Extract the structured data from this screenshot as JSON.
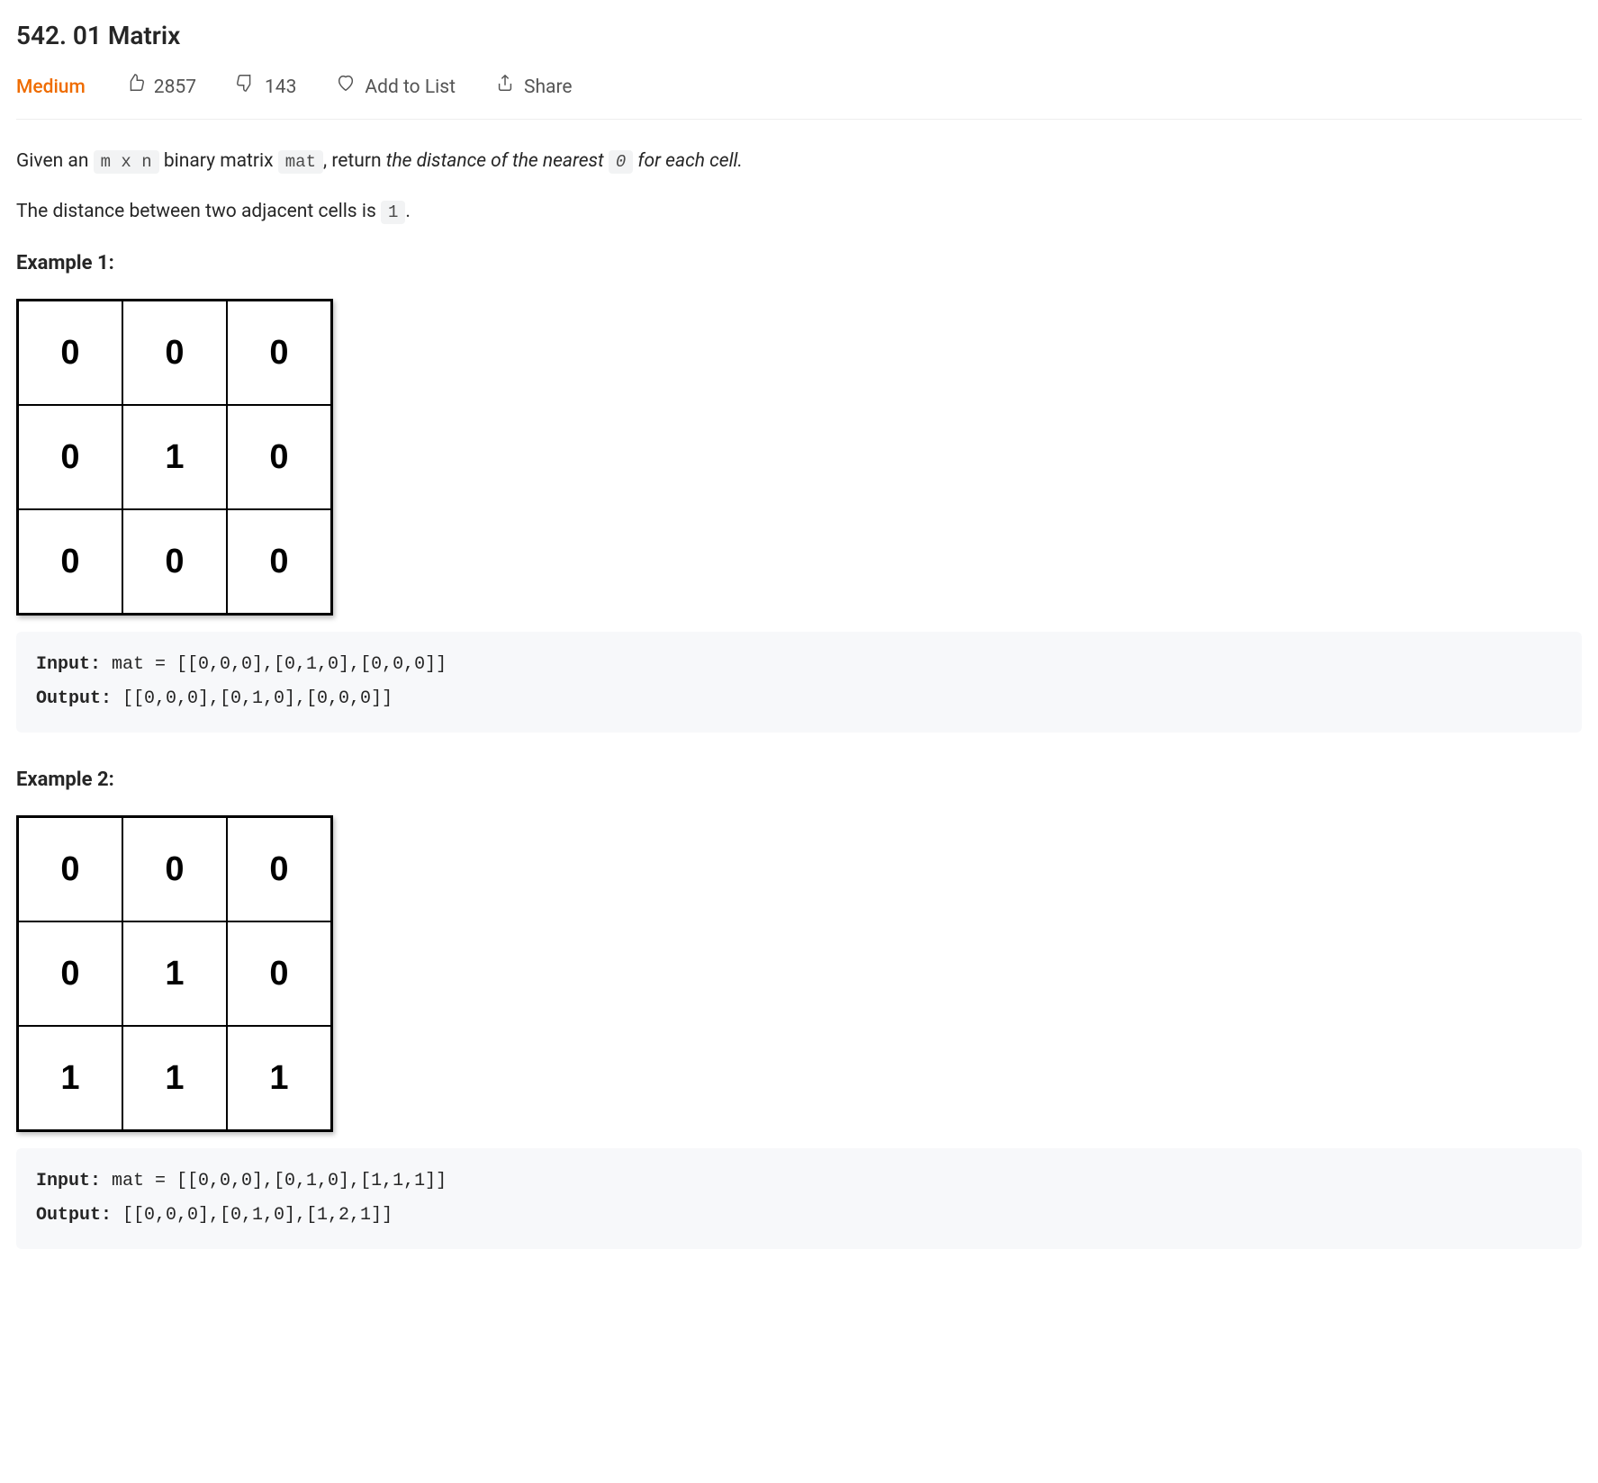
{
  "title": "542. 01 Matrix",
  "meta": {
    "difficulty": "Medium",
    "likes": "2857",
    "dislikes": "143",
    "add_to_list": "Add to List",
    "share": "Share"
  },
  "description": {
    "p1_parts": {
      "t1": "Given an ",
      "code1": "m x n",
      "t2": " binary matrix ",
      "code2": "mat",
      "t3": ", return ",
      "em1": "the distance of the nearest ",
      "code3": "0",
      "em2": " for each cell.",
      "t4": ""
    },
    "p2_parts": {
      "t1": "The distance between two adjacent cells is ",
      "code1": "1",
      "t2": "."
    }
  },
  "examples": [
    {
      "label": "Example 1:",
      "matrix": [
        [
          "0",
          "0",
          "0"
        ],
        [
          "0",
          "1",
          "0"
        ],
        [
          "0",
          "0",
          "0"
        ]
      ],
      "code": {
        "input_label": "Input:",
        "input_rest": " mat = [[0,0,0],[0,1,0],[0,0,0]]",
        "output_label": "Output:",
        "output_rest": " [[0,0,0],[0,1,0],[0,0,0]]"
      }
    },
    {
      "label": "Example 2:",
      "matrix": [
        [
          "0",
          "0",
          "0"
        ],
        [
          "0",
          "1",
          "0"
        ],
        [
          "1",
          "1",
          "1"
        ]
      ],
      "code": {
        "input_label": "Input:",
        "input_rest": " mat = [[0,0,0],[0,1,0],[1,1,1]]",
        "output_label": "Output:",
        "output_rest": " [[0,0,0],[0,1,0],[1,2,1]]"
      }
    }
  ]
}
